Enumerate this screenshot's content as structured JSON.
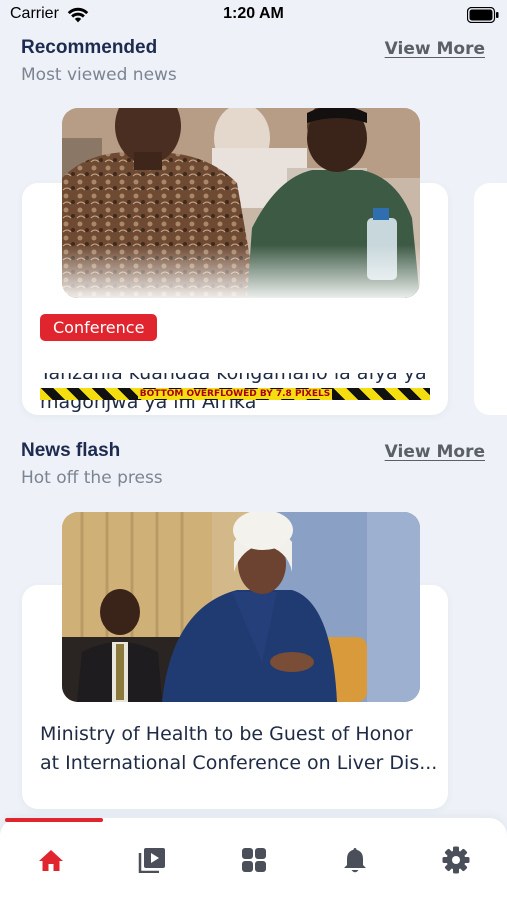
{
  "status_bar": {
    "carrier": "Carrier",
    "time": "1:20 AM"
  },
  "recommended": {
    "title": "Recommended",
    "subtitle": "Most viewed news",
    "view_more": "View More",
    "article": {
      "tag": "Conference",
      "title": "Tanzania kuandaa kongamano la afya ya magonjwa ya ini Afrika",
      "overflow_warning": "BOTTOM OVERFLOWED BY 7.8 PIXELS"
    }
  },
  "news_flash": {
    "title": "News flash",
    "subtitle": "Hot off the press",
    "view_more": "View More",
    "article": {
      "title_line1": "Ministry of Health to be Guest of Honor",
      "title_line2": "at International Conference on Liver Dis..."
    }
  },
  "bottom_nav": {
    "items": [
      {
        "icon": "home-icon",
        "active": true
      },
      {
        "icon": "video-library-icon",
        "active": false
      },
      {
        "icon": "grid-icon",
        "active": false
      },
      {
        "icon": "notification-bell-icon",
        "active": false
      },
      {
        "icon": "settings-gear-icon",
        "active": false
      }
    ]
  },
  "colors": {
    "accent": "#e0252f",
    "background": "#eef2f8",
    "heading": "#1c2b4f",
    "inactive_icon": "#4a4f59"
  }
}
